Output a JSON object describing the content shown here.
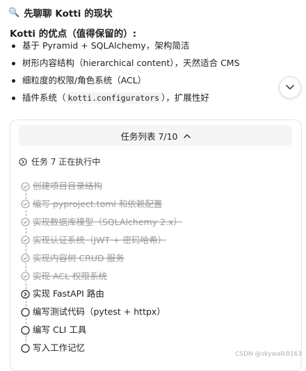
{
  "heading": {
    "icon": "magnifier-icon",
    "text": "先聊聊 Kotti 的现状"
  },
  "subheading": "Kotti 的优点（值得保留的）:",
  "bullets": [
    {
      "text": "基于 Pyramid + SQLAlchemy，架构简洁"
    },
    {
      "text": "树形内容结构（hierarchical content），天然适合 CMS"
    },
    {
      "text": "细粒度的权限/角色系统（ACL）"
    },
    {
      "pre": "插件系统（",
      "code": "kotti.configurators",
      "post": "），扩展性好"
    }
  ],
  "task_panel": {
    "title": "任务列表 7/10",
    "collapse_icon": "chevron-up-icon",
    "status_text": "任务 7 正在执行中",
    "tasks": [
      {
        "label": "创建项目目录结构",
        "state": "done"
      },
      {
        "label": "编写 pyproject.toml 和依赖配置",
        "state": "done"
      },
      {
        "label": "实现数据库模型（SQLAlchemy 2.x）",
        "state": "done"
      },
      {
        "label": "实现认证系统（JWT + 密码哈希）",
        "state": "done"
      },
      {
        "label": "实现内容树 CRUD 服务",
        "state": "done"
      },
      {
        "label": "实现 ACL 权限系统",
        "state": "done"
      },
      {
        "label": "实现 FastAPI 路由",
        "state": "in-progress"
      },
      {
        "label": "编写测试代码（pytest + httpx）",
        "state": "pending"
      },
      {
        "label": "编写 CLI 工具",
        "state": "pending"
      },
      {
        "label": "写入工作记忆",
        "state": "pending"
      }
    ]
  },
  "watermark": "CSDN @skywalk8163",
  "colors": {
    "done": "#9a9a9a",
    "text": "#1f1f1f",
    "panel_border": "#e3e3e3",
    "header_bg": "#f5f5f5"
  }
}
